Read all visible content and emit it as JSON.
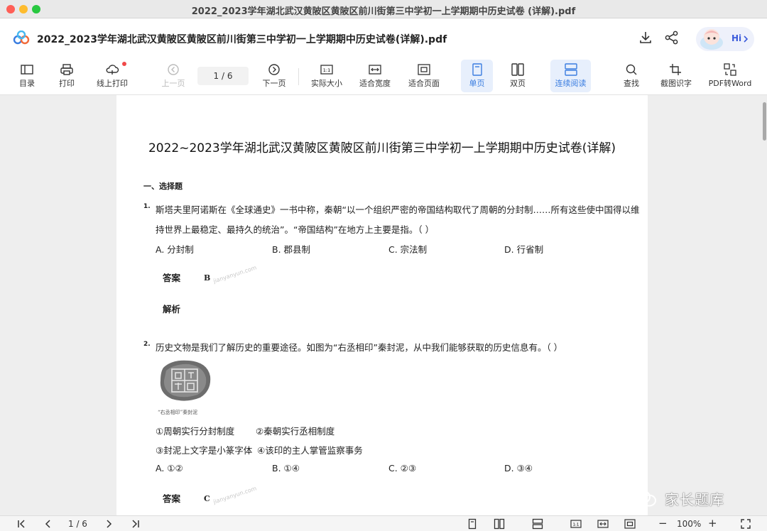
{
  "window": {
    "title": "2022_2023学年湖北武汉黄陂区黄陂区前川街第三中学初一上学期期中历史试卷 (详解).pdf"
  },
  "header": {
    "doc_title": "2022_2023学年湖北武汉黄陂区黄陂区前川街第三中学初一上学期期中历史试卷(详解).pdf",
    "hi_label": "Hi"
  },
  "toolbar": {
    "toc": "目录",
    "print": "打印",
    "online_print": "线上打印",
    "prev_page": "上一页",
    "page_indicator": "1  /  6",
    "next_page": "下一页",
    "actual_size": "实际大小",
    "fit_width": "适合宽度",
    "fit_page": "适合页面",
    "single_page": "单页",
    "double_page": "双页",
    "continuous": "连续阅读",
    "search": "查找",
    "ocr": "截图识字",
    "pdf_to_word": "PDF转Word",
    "actual_size_glyph": "1:1"
  },
  "document": {
    "title": "2022~2023学年湖北武汉黄陂区黄陂区前川街第三中学初一上学期期中历史试卷(详解)",
    "section": "一、选择题",
    "q1": {
      "num": "1.",
      "line1": "斯塔夫里阿诺斯在《全球通史》一书中称，秦朝“以一个组织严密的帝国结构取代了周朝的分封制……所有这些使中国得以维",
      "line2": "持世界上最稳定、最持久的统治”。“帝国结构”在地方上主要是指。（      ）",
      "options": [
        "A. 分封制",
        "B. 郡县制",
        "C. 宗法制",
        "D. 行省制"
      ],
      "answer_label": "答案",
      "answer": "B",
      "analysis_label": "解析"
    },
    "q2": {
      "num": "2.",
      "line1": "历史文物是我们了解历史的重要途径。如图为“右丞相印”秦封泥，从中我们能够获取的历史信息有。（      ）",
      "caption": "“右丞相印”秦封泥",
      "stmts": [
        "①周朝实行分封制度",
        "②秦朝实行丞相制度",
        "③封泥上文字是小篆字体",
        "④该印的主人掌管监察事务"
      ],
      "options": [
        "A. ①②",
        "B. ①④",
        "C. ②③",
        "D. ③④"
      ],
      "answer_label": "答案",
      "answer": "C"
    },
    "watermark_text": "jianyanyun.com"
  },
  "statusbar": {
    "page": "1  /  6",
    "zoom": "100%",
    "zoom_minus": "−",
    "zoom_plus": "+"
  },
  "overlay": {
    "brand": "家长题库"
  }
}
